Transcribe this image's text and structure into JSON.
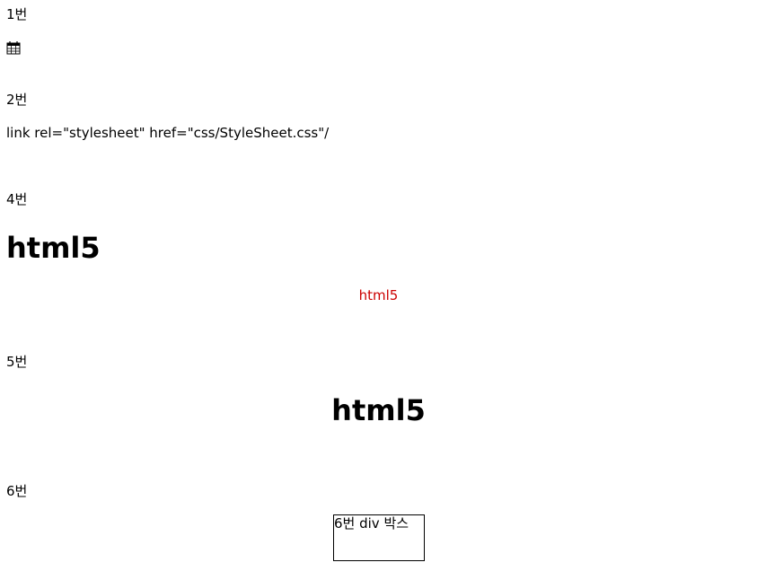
{
  "sections": {
    "s1": {
      "label": "1번",
      "icon": "calendar-icon"
    },
    "s2": {
      "label": "2번",
      "code": "link rel=\"stylesheet\" href=\"css/StyleSheet.css\"/"
    },
    "s4": {
      "label": "4번",
      "heading": "html5",
      "centered_text": "html5",
      "centered_color": "#cc0000"
    },
    "s5": {
      "label": "5번",
      "centered_heading": "html5"
    },
    "s6": {
      "label": "6번",
      "box_text": "6번 div 박스"
    }
  }
}
